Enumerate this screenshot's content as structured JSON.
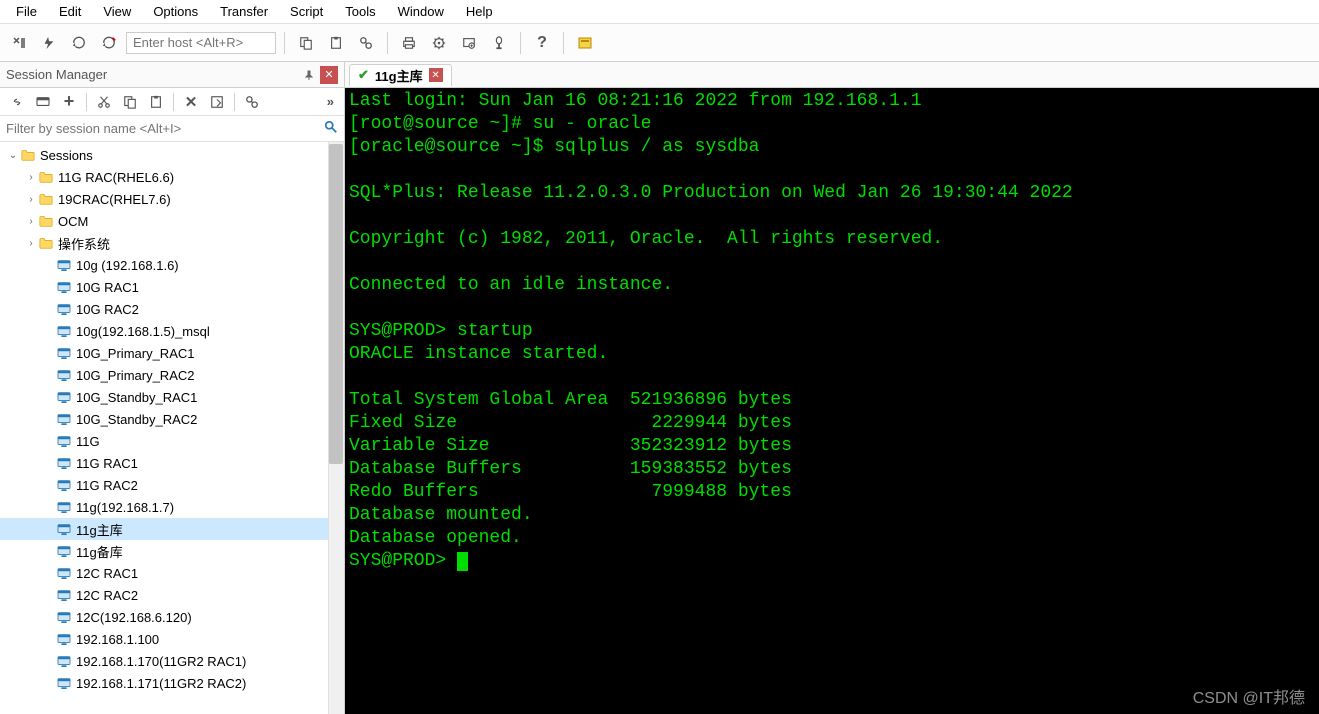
{
  "menu": [
    "File",
    "Edit",
    "View",
    "Options",
    "Transfer",
    "Script",
    "Tools",
    "Window",
    "Help"
  ],
  "host_placeholder": "Enter host <Alt+R>",
  "side": {
    "title": "Session Manager",
    "filter_placeholder": "Filter by session name <Alt+I>",
    "root": "Sessions",
    "folders": [
      "11G RAC(RHEL6.6)",
      "19CRAC(RHEL7.6)",
      "OCM",
      "操作系统"
    ],
    "sessions": [
      "10g (192.168.1.6)",
      "10G RAC1",
      "10G RAC2",
      "10g(192.168.1.5)_msql",
      "10G_Primary_RAC1",
      "10G_Primary_RAC2",
      "10G_Standby_RAC1",
      "10G_Standby_RAC2",
      "11G",
      "11G RAC1",
      "11G RAC2",
      "11g(192.168.1.7)",
      "11g主库",
      "11g备库",
      "12C RAC1",
      "12C RAC2",
      "12C(192.168.6.120)",
      "192.168.1.100",
      "192.168.1.170(11GR2 RAC1)",
      "192.168.1.171(11GR2 RAC2)"
    ],
    "selected_index": 12
  },
  "tab": {
    "label": "11g主库"
  },
  "term": {
    "lines": [
      "Last login: Sun Jan 16 08:21:16 2022 from 192.168.1.1",
      "[root@source ~]# su - oracle",
      "[oracle@source ~]$ sqlplus / as sysdba",
      "",
      "SQL*Plus: Release 11.2.0.3.0 Production on Wed Jan 26 19:30:44 2022",
      "",
      "Copyright (c) 1982, 2011, Oracle.  All rights reserved.",
      "",
      "Connected to an idle instance.",
      "",
      "SYS@PROD> startup",
      "ORACLE instance started.",
      "",
      "Total System Global Area  521936896 bytes",
      "Fixed Size                  2229944 bytes",
      "Variable Size             352323912 bytes",
      "Database Buffers          159383552 bytes",
      "Redo Buffers                7999488 bytes",
      "Database mounted.",
      "Database opened.",
      "SYS@PROD> "
    ]
  },
  "watermark": "CSDN @IT邦德"
}
